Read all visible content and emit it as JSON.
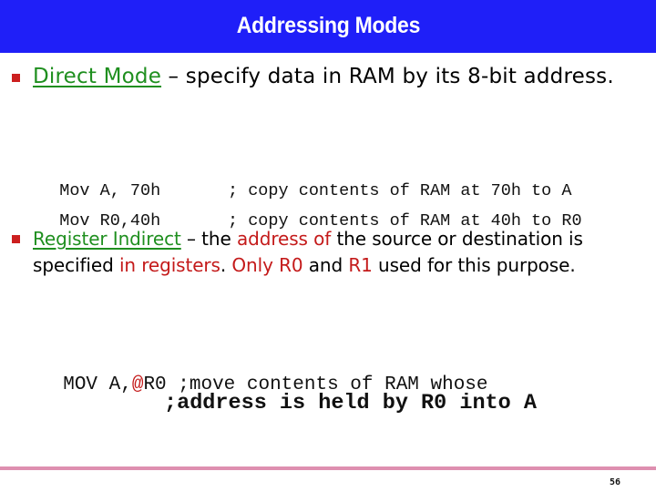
{
  "slide": {
    "title": "Addressing Modes",
    "page_number": "56",
    "colors": {
      "title_bar": "#1f1ff8",
      "title_text": "#ffffff",
      "bullet": "#cc1f1f",
      "term_green": "#1f8f1f",
      "emphasis_red": "#c41a1a",
      "footer_line": "#de8fb0"
    }
  },
  "bullets": [
    {
      "icon": "square-bullet-icon",
      "term": "Direct Mode",
      "text": " – specify data in RAM by its 8-bit address."
    },
    {
      "icon": "square-bullet-icon",
      "term": "Register Indirect",
      "segments": [
        {
          "text": " – the ",
          "style": "normal"
        },
        {
          "text": "address of",
          "style": "red"
        },
        {
          "text": " the source or destination is specified ",
          "style": "normal"
        },
        {
          "text": "in registers",
          "style": "red"
        },
        {
          "text": ". ",
          "style": "normal"
        },
        {
          "text": "Only R0",
          "style": "red"
        },
        {
          "text": " and ",
          "style": "normal"
        },
        {
          "text": "R1",
          "style": "red"
        },
        {
          "text": " used for this purpose.",
          "style": "normal"
        }
      ]
    }
  ],
  "direct_examples": [
    {
      "instruction": "Mov A, 70h",
      "comment": "; copy contents of RAM at 70h to A"
    },
    {
      "instruction": "Mov R0,40h",
      "comment": "; copy contents of RAM at 40h to R0"
    }
  ],
  "indirect_example": {
    "line1_prefix": "MOV A,",
    "line1_at": "@",
    "line1_suffix": "R0 ;move contents of RAM whose",
    "line2": ";address is held by R0 into A"
  }
}
